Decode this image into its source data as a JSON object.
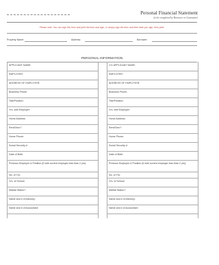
{
  "header": {
    "title": "Personal Financial Statement",
    "subtitle": "(to be completed by Borrower or Guarantor)",
    "notice": "Please note: You can sign this form and print the form and sign, or simply sign the form and then date you sign, then print."
  },
  "property": {
    "property_name_label": "Property Name:",
    "address_label": "Address:",
    "borrower_label": "Borrower:"
  },
  "section": {
    "title": "PERSONAL INFORMATION"
  },
  "left_fields": [
    "APPLICANT NAME:",
    "EMPLOYER:",
    "ADDRESS OF EMPLOYER:",
    "Business Phone:",
    "Title/Position:",
    "Yrs. with Employer:",
    "Home Address:",
    "Rent/Own?:",
    "Home Phone:",
    "Social Security #:",
    "Date of Birth:",
    "Previous Employer & Position (if with current employer less than 2 yrs):",
    "No. of Yrs:",
    "Yrs. of School:",
    "Marital Status?:",
    "Name and # of Attorney:",
    "Name and # of Accountant:"
  ],
  "right_fields": [
    "CO-APPLICANT NAME:",
    "EMPLOYER:",
    "ADDRESS OF EMPLOYER:",
    "Business Phone:",
    "Title/Position:",
    "Yrs. with Employer:",
    "Home Address:",
    "Rent/Own?:",
    "Home Phone:",
    "Social Security #:",
    "Date of Birth:",
    "Previous Employer & Position (if with current employer less than 2 yrs):",
    "No. of Yrs:",
    "Yrs. of School:",
    "Marital Status?:",
    "Name and # of Attorney:",
    "Name and # of Accountant:"
  ]
}
